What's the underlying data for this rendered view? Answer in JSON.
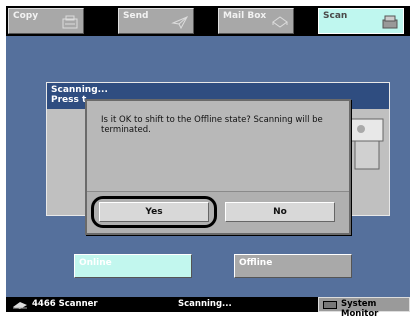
{
  "tabs": {
    "copy": "Copy",
    "send": "Send",
    "mailbox": "Mail Box",
    "scan": "Scan"
  },
  "background_window": {
    "line1": "Scanning...",
    "line2": "Press t"
  },
  "dialog": {
    "message": "Is it OK to shift to the Offline state? Scanning will be terminated.",
    "yes_label": "Yes",
    "no_label": "No"
  },
  "mode_buttons": {
    "online_label": "Online",
    "offline_label": "Offline"
  },
  "status_bar": {
    "job": "4466 Scanner",
    "state": "Scanning...",
    "system_monitor_label": "System Monitor"
  },
  "colors": {
    "main_bg": "#55709c",
    "active_tab": "#bff7ef",
    "dialog_bg": "#b8b8b8"
  }
}
